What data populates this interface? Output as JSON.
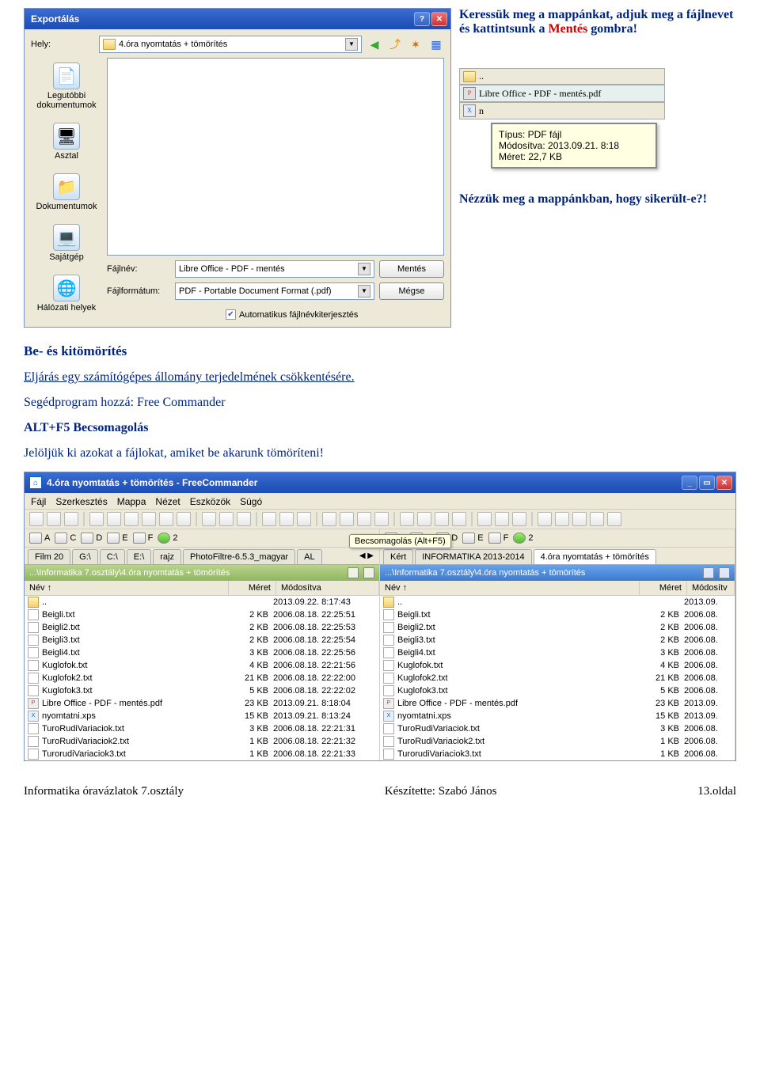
{
  "instruction1_a": "Keressük meg a mappánkat, adjuk meg a fájlnevet és kattintsunk a ",
  "instruction1_b": "Mentés",
  "instruction1_c": " gombra!",
  "instruction2": "Nézzük meg a mappánkban, hogy sikerült-e?!",
  "export_dialog": {
    "title": "Exportálás",
    "location_label": "Hely:",
    "location_value": "4.óra nyomtatás + tömörítés",
    "sidebar": [
      "Legutóbbi dokumentumok",
      "Asztal",
      "Dokumentumok",
      "Sajátgép",
      "Hálózati helyek"
    ],
    "filename_label": "Fájlnév:",
    "filename_value": "Libre Office - PDF - mentés",
    "format_label": "Fájlformátum:",
    "format_value": "PDF - Portable Document Format (.pdf)",
    "save_btn": "Mentés",
    "cancel_btn": "Mégse",
    "auto_ext": "Automatikus fájlnévkiterjesztés"
  },
  "tooltip": {
    "updir": "..",
    "file1": "Libre Office - PDF - mentés.pdf",
    "file2_prefix": "n",
    "line1": "Típus: PDF fájl",
    "line2": "Módosítva: 2013.09.21. 8:18",
    "line3": "Méret: 22,7 KB"
  },
  "mid": {
    "heading": "Be- és kitömörítés",
    "def": "Eljárás egy számítógépes állomány terjedelmének csökkentésére.",
    "helper": "Segédprogram hozzá: Free Commander",
    "shortcut": "ALT+F5 Becsomagolás",
    "select": "Jelöljük ki azokat a fájlokat, amiket be akarunk tömöríteni!"
  },
  "fc": {
    "title": "4.óra nyomtatás + tömörítés - FreeCommander",
    "menu": [
      "Fájl",
      "Szerkesztés",
      "Mappa",
      "Nézet",
      "Eszközök",
      "Súgó"
    ],
    "balloon": "Becsomagolás (Alt+F5)",
    "drives": [
      "A",
      "C",
      "D",
      "E",
      "F",
      "2"
    ],
    "left_tabs": [
      "Film 20",
      "G:\\",
      "C:\\",
      "E:\\",
      "rajz",
      "PhotoFiltre-6.5.3_magyar",
      "AL"
    ],
    "right_tabs": [
      "Kért",
      "INFORMATIKA 2013-2014",
      "4.óra nyomtatás + tömörítés"
    ],
    "path": "...\\Informatika 7.osztály\\4.óra nyomtatás + tömörítés",
    "columns": {
      "name": "Név",
      "size": "Méret",
      "date_full": "Módosítva",
      "date_short": "Módosítv"
    },
    "files": [
      {
        "name": "..",
        "size": "",
        "date": "2013.09.22. 8:17:43",
        "icon": "fldr"
      },
      {
        "name": "Beigli.txt",
        "size": "2 KB",
        "date": "2006.08.18. 22:25:51",
        "icon": "txt"
      },
      {
        "name": "Beigli2.txt",
        "size": "2 KB",
        "date": "2006.08.18. 22:25:53",
        "icon": "txt"
      },
      {
        "name": "Beigli3.txt",
        "size": "2 KB",
        "date": "2006.08.18. 22:25:54",
        "icon": "txt"
      },
      {
        "name": "Beigli4.txt",
        "size": "3 KB",
        "date": "2006.08.18. 22:25:56",
        "icon": "txt"
      },
      {
        "name": "Kuglofok.txt",
        "size": "4 KB",
        "date": "2006.08.18. 22:21:56",
        "icon": "txt"
      },
      {
        "name": "Kuglofok2.txt",
        "size": "21 KB",
        "date": "2006.08.18. 22:22:00",
        "icon": "txt"
      },
      {
        "name": "Kuglofok3.txt",
        "size": "5 KB",
        "date": "2006.08.18. 22:22:02",
        "icon": "txt"
      },
      {
        "name": "Libre Office - PDF - mentés.pdf",
        "size": "23 KB",
        "date": "2013.09.21. 8:18:04",
        "icon": "pdf"
      },
      {
        "name": "nyomtatni.xps",
        "size": "15 KB",
        "date": "2013.09.21. 8:13:24",
        "icon": "xps"
      },
      {
        "name": "TuroRudiVariaciok.txt",
        "size": "3 KB",
        "date": "2006.08.18. 22:21:31",
        "icon": "txt"
      },
      {
        "name": "TuroRudiVariaciok2.txt",
        "size": "1 KB",
        "date": "2006.08.18. 22:21:32",
        "icon": "txt"
      },
      {
        "name": "TurorudiVariaciok3.txt",
        "size": "1 KB",
        "date": "2006.08.18. 22:21:33",
        "icon": "txt"
      }
    ],
    "right_dates": [
      "2013.09.",
      "2006.08.",
      "2006.08.",
      "2006.08.",
      "2006.08.",
      "2006.08.",
      "2006.08.",
      "2006.08.",
      "2013.09.",
      "2013.09.",
      "2006.08.",
      "2006.08.",
      "2006.08."
    ]
  },
  "footer": {
    "left": "Informatika óravázlatok 7.osztály",
    "center": "Készítette: Szabó János",
    "right": "13.oldal"
  }
}
